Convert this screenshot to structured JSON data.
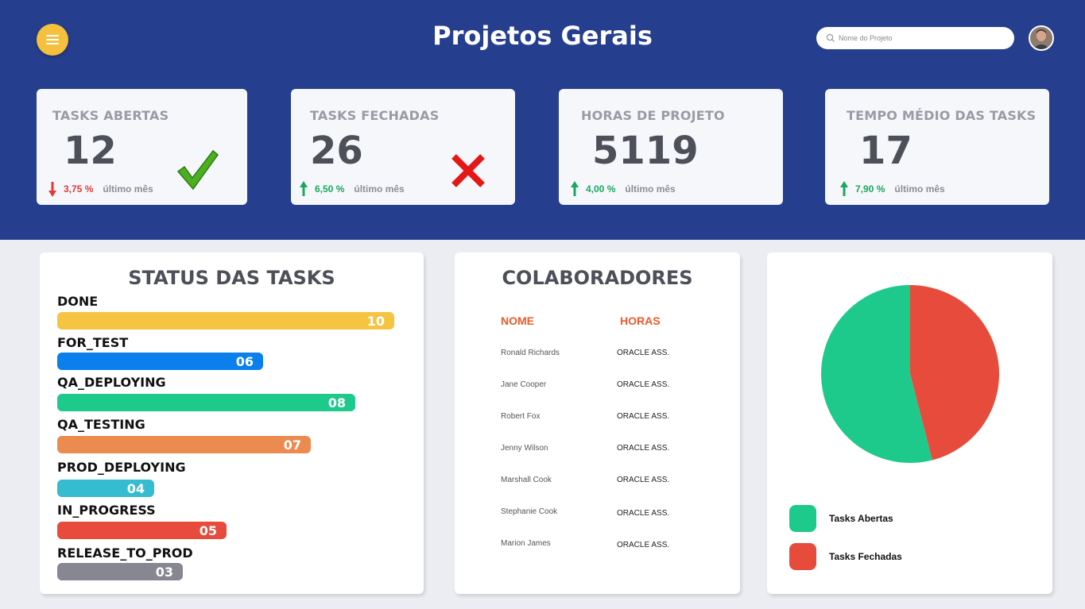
{
  "header": {
    "title": "Projetos Gerais",
    "search_placeholder": "Nome do Projeto",
    "menu_icon": "hamburger-icon",
    "search_icon": "search-icon",
    "bg_color": "#253e8e",
    "accent": "#f5c13c"
  },
  "kpis": [
    {
      "label": "TASKS ABERTAS",
      "value": "12",
      "trend": "down",
      "pct": "3,75 %",
      "since": "último mês",
      "icon": "check-icon"
    },
    {
      "label": "TASKS FECHADAS",
      "value": "26",
      "trend": "up",
      "pct": "6,50 %",
      "since": "último mês",
      "icon": "cross-icon"
    },
    {
      "label": "HORAS DE PROJETO",
      "value": "5119",
      "trend": "up",
      "pct": "4,00 %",
      "since": "último mês"
    },
    {
      "label": "TEMPO MÉDIO DAS TASKS",
      "value": "17",
      "trend": "up",
      "pct": "7,90 %",
      "since": "último mês"
    }
  ],
  "status": {
    "title": "STATUS DAS TASKS",
    "items": [
      {
        "label": "DONE",
        "value": "10",
        "color": "#f5c542"
      },
      {
        "label": "FOR_TEST",
        "value": "06",
        "color": "#0b80ec"
      },
      {
        "label": "QA_DEPLOYING",
        "value": "08",
        "color": "#1dc98b"
      },
      {
        "label": "QA_TESTING",
        "value": "07",
        "color": "#ec8b4f"
      },
      {
        "label": "PROD_DEPLOYING",
        "value": "04",
        "color": "#36bcd0"
      },
      {
        "label": "IN_PROGRESS",
        "value": "05",
        "color": "#e64b3c"
      },
      {
        "label": "RELEASE_TO_PROD",
        "value": "03",
        "color": "#868791"
      }
    ]
  },
  "collaborators": {
    "title": "COLABORADORES",
    "col_name": "NOME",
    "col_hours": "HORAS",
    "rows": [
      {
        "name": "Ronald Richards",
        "hours": "ORACLE ASS."
      },
      {
        "name": "Jane Cooper",
        "hours": "ORACLE ASS."
      },
      {
        "name": "Robert Fox",
        "hours": "ORACLE ASS."
      },
      {
        "name": "Jenny Wilson",
        "hours": "ORACLE ASS."
      },
      {
        "name": "Marshall Cook",
        "hours": "ORACLE ASS."
      },
      {
        "name": "Stephanie Cook",
        "hours": "ORACLE ASS."
      },
      {
        "name": "Marion James",
        "hours": "ORACLE ASS."
      }
    ]
  },
  "chart_data": {
    "type": "pie",
    "title": "",
    "slices": [
      {
        "name": "Tasks Abertas",
        "value": 54,
        "color": "#1dc98b"
      },
      {
        "name": "Tasks Fechadas",
        "value": 46,
        "color": "#e64b3c"
      }
    ],
    "legend_position": "bottom-left"
  }
}
